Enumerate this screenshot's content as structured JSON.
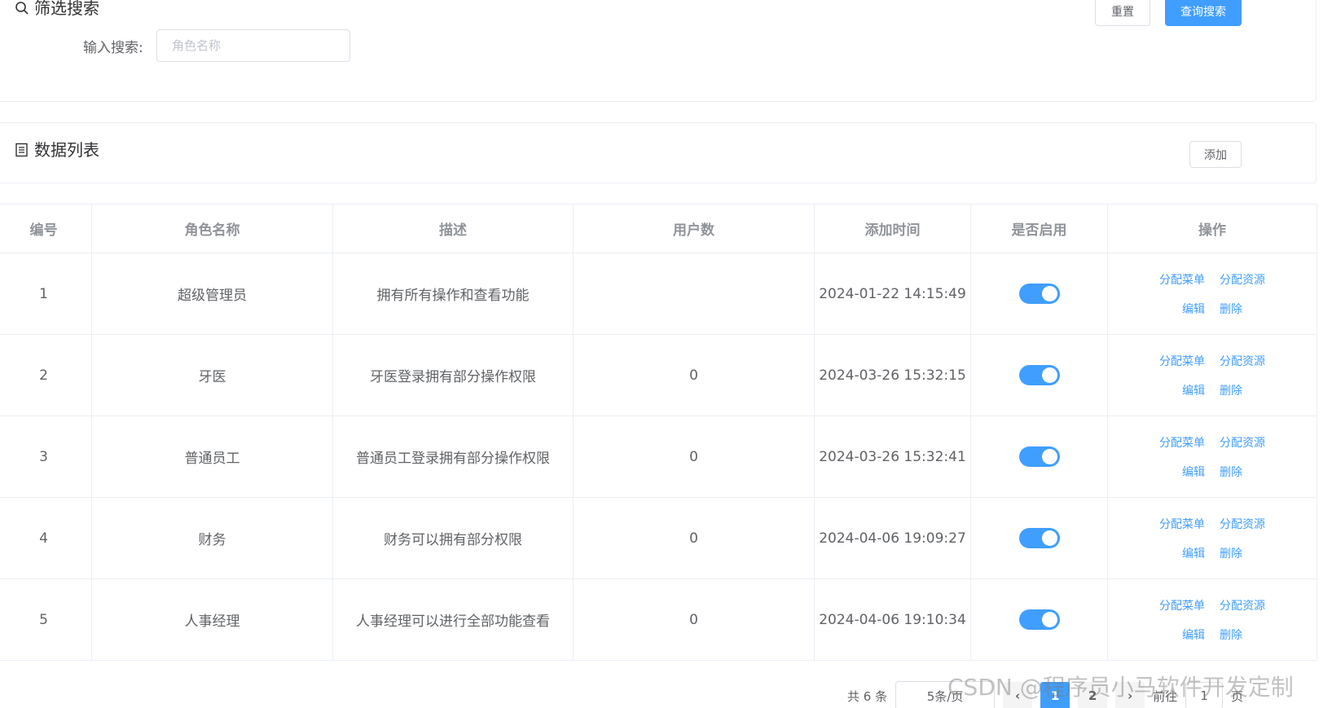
{
  "filter": {
    "title": "筛选搜索",
    "reset_label": "重置",
    "search_label": "查询搜索",
    "input_label": "输入搜索:",
    "input_placeholder": "角色名称",
    "input_value": ""
  },
  "list": {
    "title": "数据列表",
    "add_label": "添加"
  },
  "table": {
    "headers": [
      "编号",
      "角色名称",
      "描述",
      "用户数",
      "添加时间",
      "是否启用",
      "操作"
    ],
    "rows": [
      {
        "id": "1",
        "name": "超级管理员",
        "desc": "拥有所有操作和查看功能",
        "users": "",
        "time": "2024-01-22 14:15:49",
        "enabled": true
      },
      {
        "id": "2",
        "name": "牙医",
        "desc": "牙医登录拥有部分操作权限",
        "users": "0",
        "time": "2024-03-26 15:32:15",
        "enabled": true
      },
      {
        "id": "3",
        "name": "普通员工",
        "desc": "普通员工登录拥有部分操作权限",
        "users": "0",
        "time": "2024-03-26 15:32:41",
        "enabled": true
      },
      {
        "id": "4",
        "name": "财务",
        "desc": "财务可以拥有部分权限",
        "users": "0",
        "time": "2024-04-06 19:09:27",
        "enabled": true
      },
      {
        "id": "5",
        "name": "人事经理",
        "desc": "人事经理可以进行全部功能查看",
        "users": "0",
        "time": "2024-04-06 19:10:34",
        "enabled": true
      }
    ],
    "actions": {
      "assign_menu": "分配菜单",
      "assign_resource": "分配资源",
      "edit": "编辑",
      "delete": "删除"
    }
  },
  "pagination": {
    "total": "共 6 条",
    "page_size": "5条/页",
    "prev": "‹",
    "pages": [
      "1",
      "2"
    ],
    "current": "1",
    "next": "›",
    "goto_label": "前往",
    "goto_value": "1",
    "page_suffix": "页"
  },
  "watermark": "CSDN @程序员小马软件开发定制",
  "colors": {
    "accent": "#409eff",
    "border": "#ebeef5",
    "header_text": "#909399"
  }
}
